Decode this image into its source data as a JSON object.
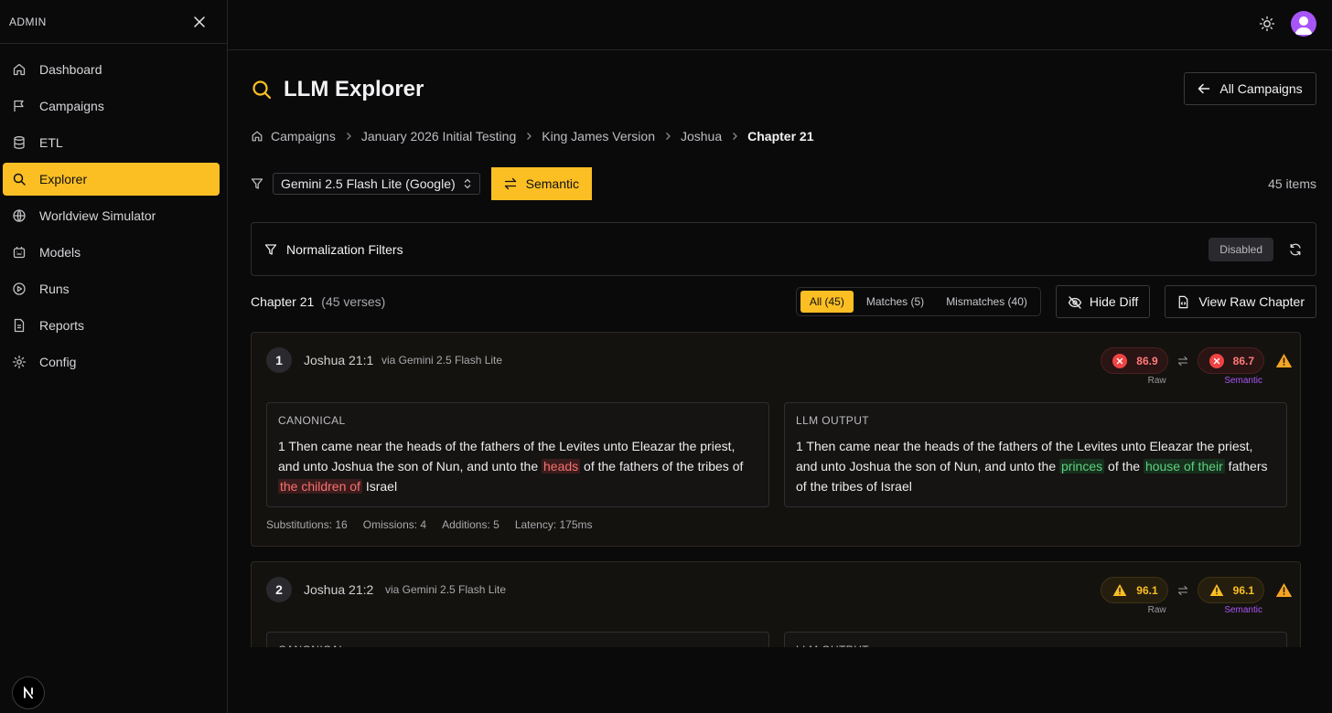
{
  "sidebar": {
    "title": "ADMIN",
    "items": [
      {
        "label": "Dashboard",
        "icon": "home-icon"
      },
      {
        "label": "Campaigns",
        "icon": "flag-icon"
      },
      {
        "label": "ETL",
        "icon": "database-icon"
      },
      {
        "label": "Explorer",
        "icon": "search-icon",
        "active": true
      },
      {
        "label": "Worldview Simulator",
        "icon": "globe-icon"
      },
      {
        "label": "Models",
        "icon": "cpu-icon"
      },
      {
        "label": "Runs",
        "icon": "play-circle-icon"
      },
      {
        "label": "Reports",
        "icon": "file-text-icon"
      },
      {
        "label": "Config",
        "icon": "gear-icon"
      }
    ],
    "logo": "N"
  },
  "header": {
    "title": "LLM Explorer",
    "back_label": "All Campaigns"
  },
  "breadcrumb": [
    "Campaigns",
    "January 2026 Initial Testing",
    "King James Version",
    "Joshua",
    "Chapter 21"
  ],
  "filters": {
    "model": "Gemini 2.5 Flash Lite (Google)",
    "mode": "Semantic",
    "items_count": "45 items"
  },
  "normalization": {
    "title": "Normalization Filters",
    "status": "Disabled"
  },
  "chapter": {
    "title": "Chapter 21",
    "count": "(45 verses)",
    "tabs": [
      "All (45)",
      "Matches (5)",
      "Mismatches (40)"
    ],
    "hide_diff": "Hide Diff",
    "view_raw": "View Raw Chapter"
  },
  "labels": {
    "canonical": "CANONICAL",
    "llm_output": "LLM OUTPUT",
    "raw": "Raw",
    "semantic": "Semantic"
  },
  "verses": [
    {
      "num": "1",
      "ref": "Joshua 21:1",
      "via": "via Gemini 2.5 Flash Lite",
      "raw_score": "86.9",
      "sem_score": "86.7",
      "status": "mismatch",
      "canonical": {
        "t1": "1 Then came near the heads of the fathers of the Levites unto Eleazar the priest, and unto Joshua the son of Nun, and unto the ",
        "d1": "heads",
        "t2": " of the fathers of the tribes of ",
        "d2": "the children of",
        "t3": " Israel"
      },
      "output": {
        "t1": "1 Then came near the heads of the fathers of the Levites unto Eleazar the priest, and unto Joshua the son of Nun, and unto the ",
        "a1": "princes",
        "t2": " of the ",
        "a2": "house of their",
        "t3": " fathers of the tribes of Israel"
      },
      "stats": {
        "substitutions": "Substitutions: 16",
        "omissions": "Omissions: 4",
        "additions": "Additions: 5",
        "latency": "Latency: 175ms"
      }
    },
    {
      "num": "2",
      "ref": "Joshua 21:2",
      "via": "via Gemini 2.5 Flash Lite",
      "raw_score": "96.1",
      "sem_score": "96.1",
      "status": "warning"
    }
  ],
  "colors": {
    "accent": "#fbbf24",
    "error": "#ef4444",
    "semantic": "#a855f7",
    "added": "#5fd07e",
    "deleted": "#f87171"
  }
}
